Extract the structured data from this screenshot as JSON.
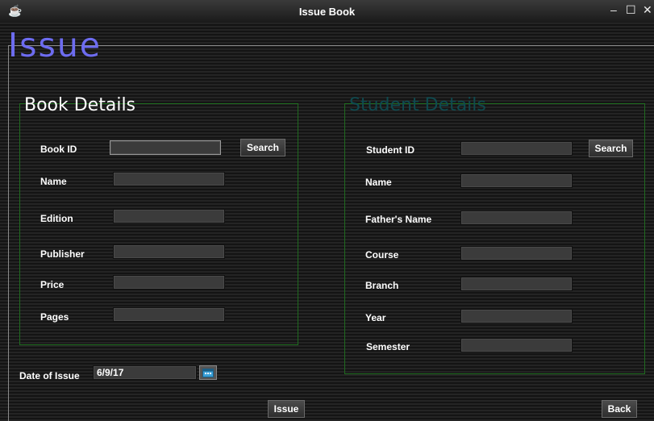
{
  "window": {
    "title": "Issue Book",
    "minimize_glyph": "–",
    "maximize_glyph": "☐",
    "close_glyph": "✕"
  },
  "heading": "Issue",
  "book": {
    "title": "Book Details",
    "search_label": "Search",
    "fields": {
      "book_id": {
        "label": "Book ID",
        "value": ""
      },
      "name": {
        "label": "Name",
        "value": ""
      },
      "edition": {
        "label": "Edition",
        "value": ""
      },
      "publisher": {
        "label": "Publisher",
        "value": ""
      },
      "price": {
        "label": "Price",
        "value": ""
      },
      "pages": {
        "label": "Pages",
        "value": ""
      }
    }
  },
  "student": {
    "title": "Student Details",
    "search_label": "Search",
    "fields": {
      "student_id": {
        "label": "Student ID",
        "value": ""
      },
      "name": {
        "label": "Name",
        "value": ""
      },
      "fathers_name": {
        "label": "Father's Name",
        "value": ""
      },
      "course": {
        "label": "Course",
        "value": ""
      },
      "branch": {
        "label": "Branch",
        "value": ""
      },
      "year": {
        "label": "Year",
        "value": ""
      },
      "semester": {
        "label": "Semester",
        "value": ""
      }
    }
  },
  "date_of_issue": {
    "label": "Date of Issue",
    "value": "6/9/17"
  },
  "buttons": {
    "issue": "Issue",
    "back": "Back"
  },
  "colors": {
    "heading": "#6d6cf0",
    "student_title": "#0f4a4f",
    "panel_border": "#1f6b1f"
  },
  "icons": {
    "app": "coffee-cup-icon",
    "calendar": "calendar-icon"
  }
}
